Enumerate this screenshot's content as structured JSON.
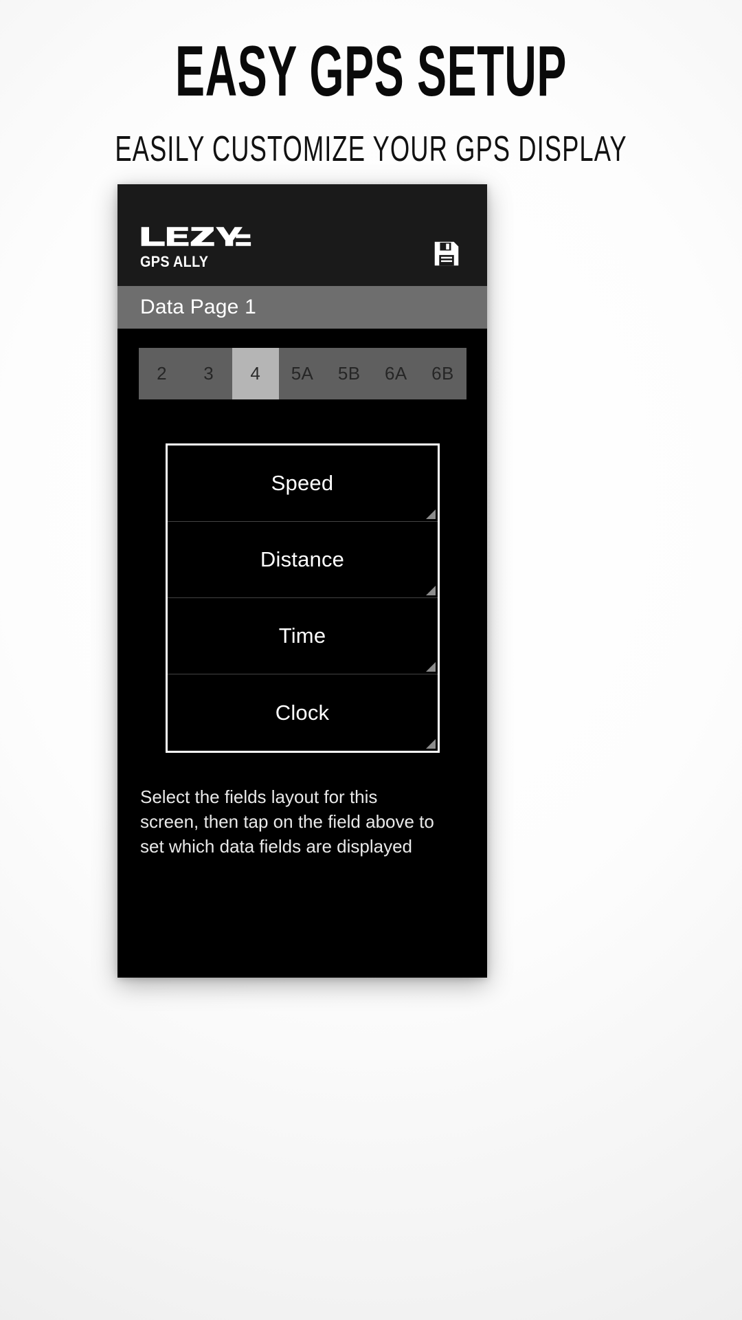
{
  "promo": {
    "headline": "EASY GPS SETUP",
    "subheadline": "EASILY CUSTOMIZE YOUR GPS DISPLAY"
  },
  "app": {
    "brand": {
      "logo_text": "LEZYNE",
      "logo_icon": "lezyne-wordmark-logo",
      "tagline": "GPS ALLY"
    },
    "header_actions": {
      "save_icon": "save-floppy-icon"
    },
    "page_title": "Data Page 1",
    "layout_tabs": {
      "selected": "4",
      "items": [
        {
          "label": "2",
          "selected": false
        },
        {
          "label": "3",
          "selected": false
        },
        {
          "label": "4",
          "selected": true
        },
        {
          "label": "5A",
          "selected": false
        },
        {
          "label": "5B",
          "selected": false
        },
        {
          "label": "6A",
          "selected": false
        },
        {
          "label": "6B",
          "selected": false
        }
      ]
    },
    "data_fields": [
      {
        "label": "Speed"
      },
      {
        "label": "Distance"
      },
      {
        "label": "Time"
      },
      {
        "label": "Clock"
      }
    ],
    "helper_text": "Select the fields layout for this screen, then tap on the field above to set which data fields are displayed"
  },
  "colors": {
    "panel_bg": "#000000",
    "header_bg": "#1a1a1a",
    "title_bar_bg": "#6e6e6e",
    "tab_bg": "#5f5f5f",
    "tab_selected_bg": "#b5b5b5",
    "text_light": "#ffffff",
    "headline_color": "#0a0a0a"
  }
}
